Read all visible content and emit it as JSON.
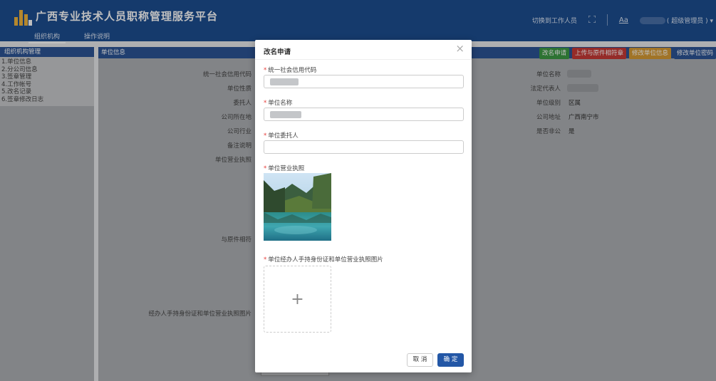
{
  "header": {
    "title": "广西专业技术人员职称管理服务平台",
    "tabs": [
      {
        "label": "组织机构",
        "active": true
      },
      {
        "label": "操作说明",
        "active": false
      }
    ],
    "switch_label": "切换到工作人员",
    "expand_icon": "fullscreen-icon",
    "font_icon_label": "Aa",
    "user_role": "( 超级管理员 )",
    "dropdown_icon": "chevron-down-icon"
  },
  "sidebar": {
    "heading": "组织机构管理",
    "items": [
      {
        "label": "1.单位信息"
      },
      {
        "label": "2.分公司信息"
      },
      {
        "label": "3.签章管理"
      },
      {
        "label": "4.工作帐号"
      },
      {
        "label": "5.改名记录"
      },
      {
        "label": "6.签章修改日志"
      }
    ]
  },
  "content": {
    "heading": "单位信息",
    "buttons": [
      {
        "label": "改名申请",
        "color": "#3d9a45"
      },
      {
        "label": "上传与原件相符章",
        "color": "#c73a36"
      },
      {
        "label": "修改单位信息",
        "color": "#d79b34"
      },
      {
        "label": "修改单位密码",
        "color": "#2c5596"
      }
    ],
    "left_labels": [
      "统一社会信用代码",
      "单位性质",
      "委托人",
      "公司所在地",
      "公司行业",
      "备注说明",
      "单位营业执照",
      "与原件相符",
      "经办人手持身份证和单位营业执照图片"
    ],
    "right_labels": [
      "单位名称",
      "法定代表人",
      "单位级别",
      "公司地址",
      "是否非公"
    ],
    "right_values": [
      "",
      "",
      "区属",
      "广西南宁市",
      "是"
    ]
  },
  "modal": {
    "title": "改名申请",
    "close_icon": "close-icon",
    "fields": [
      {
        "label": "统一社会信用代码",
        "required": true,
        "value": ""
      },
      {
        "label": "单位名称",
        "required": true,
        "value": ""
      },
      {
        "label": "单位委托人",
        "required": true,
        "value": ""
      }
    ],
    "license_label": "单位营业执照",
    "id_photo_label": "单位经办人手持身份证和单位营业执照图片",
    "upload_icon": "plus-icon",
    "upload_glyph": "+",
    "cancel_label": "取 消",
    "ok_label": "确 定"
  }
}
